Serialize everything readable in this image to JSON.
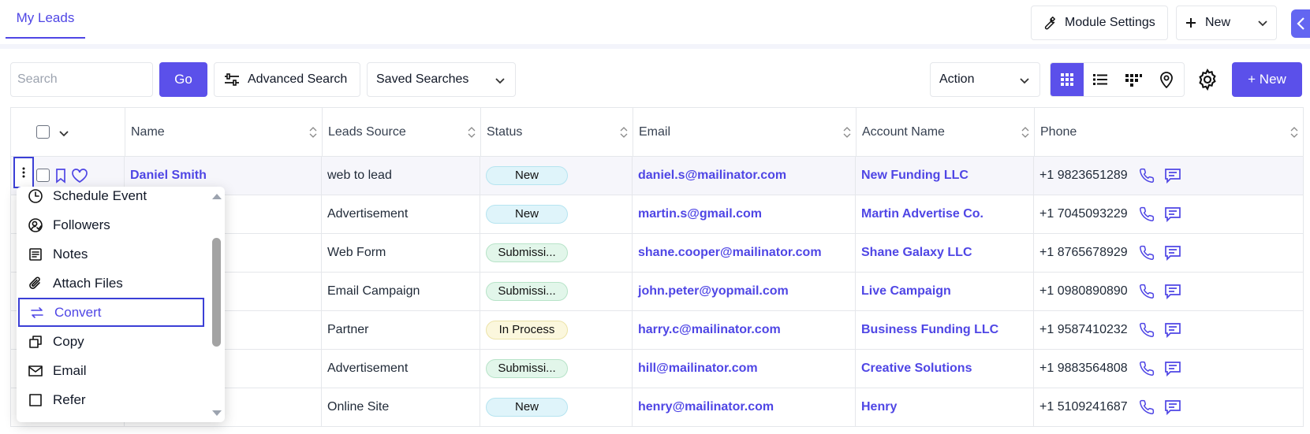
{
  "topbar": {
    "tab_label": "My Leads",
    "module_settings": "Module Settings",
    "new_label": "New"
  },
  "toolbar": {
    "search_placeholder": "Search",
    "go": "Go",
    "advanced_search": "Advanced Search",
    "saved_searches": "Saved Searches",
    "action": "Action",
    "new_button": "+ New"
  },
  "columns": [
    "Name",
    "Leads Source",
    "Status",
    "Email",
    "Account Name",
    "Phone"
  ],
  "rows": [
    {
      "name": "Daniel Smith",
      "source": "web to lead",
      "status": "New",
      "email": "daniel.s@mailinator.com",
      "account": "New Funding LLC",
      "phone": "+1 9823651289"
    },
    {
      "name": "",
      "source": "Advertisement",
      "status": "New",
      "email": "martin.s@gmail.com",
      "account": "Martin Advertise Co.",
      "phone": "+1 7045093229"
    },
    {
      "name": "",
      "source": "Web Form",
      "status": "Submissi...",
      "email": "shane.cooper@mailinator.com",
      "account": "Shane Galaxy LLC",
      "phone": "+1 8765678929"
    },
    {
      "name": "",
      "source": "Email Campaign",
      "status": "Submissi...",
      "email": "john.peter@yopmail.com",
      "account": "Live Campaign",
      "phone": "+1 0980890890"
    },
    {
      "name": "",
      "source": "Partner",
      "status": "In Process",
      "email": "harry.c@mailinator.com",
      "account": "Business Funding LLC",
      "phone": "+1 9587410232"
    },
    {
      "name": "",
      "source": "Advertisement",
      "status": "Submissi...",
      "email": "hill@mailinator.com",
      "account": "Creative Solutions",
      "phone": "+1 9883564808"
    },
    {
      "name": "",
      "source": "Online Site",
      "status": "New",
      "email": "henry@mailinator.com",
      "account": "Henry",
      "phone": "+1 5109241687"
    }
  ],
  "menu": {
    "items": [
      "Schedule Event",
      "Followers",
      "Notes",
      "Attach Files",
      "Convert",
      "Copy",
      "Email",
      "Refer"
    ],
    "selected": "Convert"
  },
  "colors": {
    "accent": "#5b50ea",
    "link": "#4f46e5",
    "badge_new": "#dff4fa",
    "badge_submission": "#e2f6ea",
    "badge_in_process": "#fbf7dd"
  }
}
